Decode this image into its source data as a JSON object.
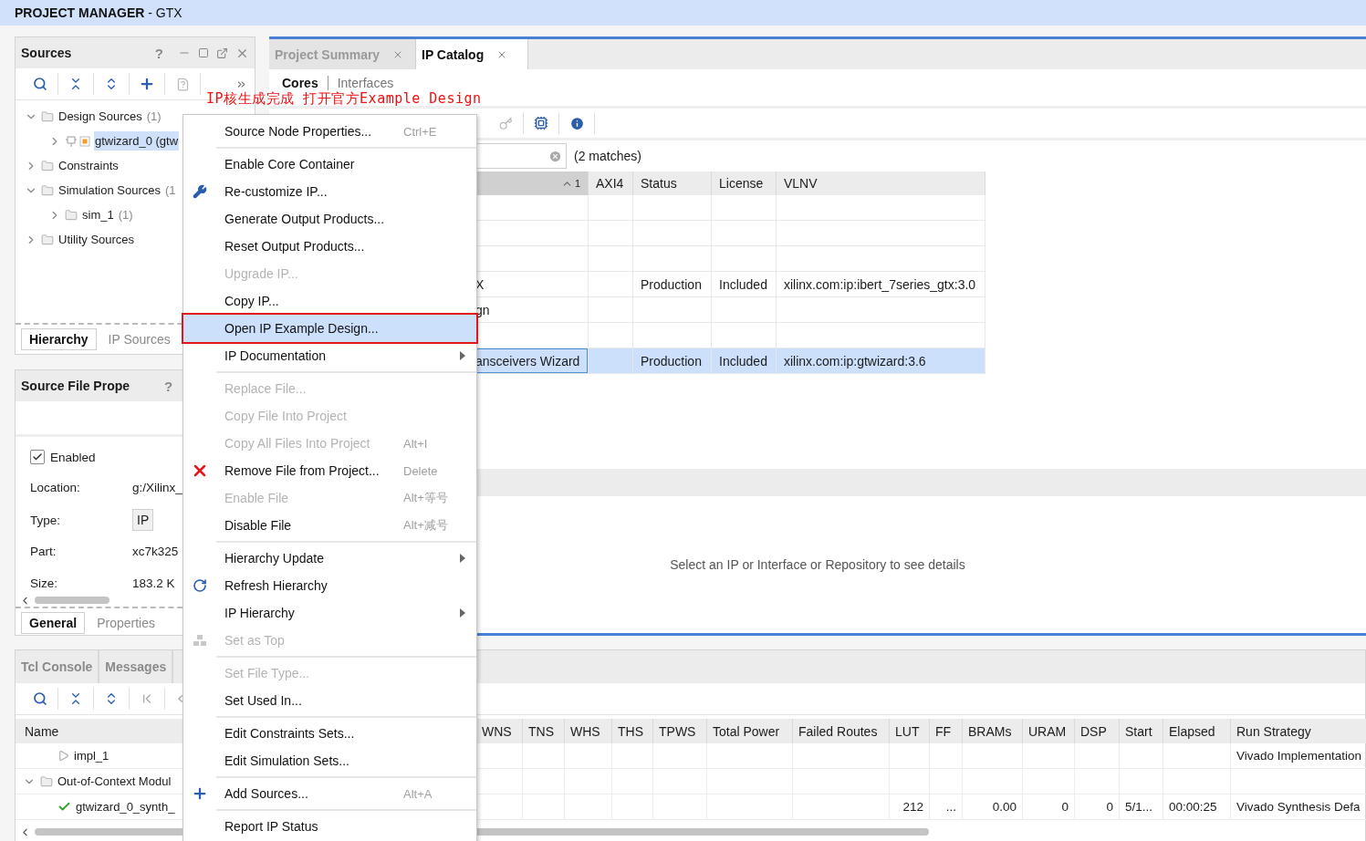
{
  "title_bar": {
    "title": "**PROJECT MANAGER** - GTX"
  },
  "sources_panel": {
    "title": "Sources",
    "help": "?",
    "tree": [
      {
        "label": "Design Sources",
        "count": "(1)",
        "kind": "folder",
        "expanded": true,
        "selected": false,
        "children": [
          {
            "label": "gtwizard_0 (gtw",
            "kind": "ip",
            "expanded": false,
            "selected": true
          }
        ]
      },
      {
        "label": "Constraints",
        "kind": "folder",
        "expanded": false,
        "selected": false
      },
      {
        "label": "Simulation Sources",
        "count": "(1",
        "kind": "folder",
        "expanded": true,
        "selected": false,
        "children": [
          {
            "label": "sim_1",
            "count": "(1)",
            "kind": "folder",
            "expanded": false,
            "selected": false
          }
        ]
      },
      {
        "label": "Utility Sources",
        "kind": "folder",
        "expanded": false,
        "selected": false
      }
    ],
    "tabs": [
      {
        "label": "Hierarchy",
        "selected": true
      },
      {
        "label": "IP Sources",
        "selected": false
      }
    ]
  },
  "properties_panel": {
    "title": "Source File Prope",
    "help": "?",
    "enabled": {
      "label": "Enabled",
      "checked": true
    },
    "fields": [
      {
        "label": "Location:",
        "value": "g:/Xilinx_",
        "kind": "text"
      },
      {
        "label": "Type:",
        "value": "IP",
        "kind": "box"
      },
      {
        "label": "Part:",
        "value": "xc7k325",
        "kind": "text"
      },
      {
        "label": "Size:",
        "value": "183.2 K",
        "kind": "text"
      }
    ],
    "tabs": [
      {
        "label": "General",
        "selected": true
      },
      {
        "label": "Properties",
        "selected": false
      }
    ]
  },
  "editor_panel": {
    "tabs": [
      {
        "label": "Project Summary",
        "selected": false
      },
      {
        "label": "IP Catalog",
        "selected": true
      }
    ],
    "subtabs": [
      {
        "label": "Cores",
        "selected": true
      },
      {
        "label": "Interfaces",
        "selected": false
      }
    ],
    "search": {
      "matches": "(2 matches)"
    },
    "table": {
      "sort_mark": "1",
      "columns": [
        "AXI4",
        "Status",
        "License",
        "VLNV"
      ],
      "rows": [
        {
          "selected": false
        },
        {
          "selected": false
        },
        {
          "selected": false
        },
        {
          "name": "X",
          "status": "Production",
          "license": "Included",
          "vlnv": "xilinx.com:ip:ibert_7series_gtx:3.0",
          "selected": false
        },
        {
          "name": "gn",
          "selected": false
        },
        {
          "selected": false
        },
        {
          "name": "ansceivers Wizard",
          "status": "Production",
          "license": "Included",
          "vlnv": "xilinx.com:ip:gtwizard:3.6",
          "selected": true
        }
      ]
    },
    "details": {
      "message": "Select an IP or Interface or Repository to see details"
    }
  },
  "runs_panel": {
    "tabs": [
      {
        "label": "Tcl Console",
        "selected": false
      },
      {
        "label": "Messages",
        "selected": false
      }
    ],
    "name_column": "Name",
    "columns": [
      "WNS",
      "TNS",
      "WHS",
      "THS",
      "TPWS",
      "Total Power",
      "Failed Routes",
      "LUT",
      "FF",
      "BRAMs",
      "URAM",
      "DSP",
      "Start",
      "Elapsed",
      "Run Strategy"
    ],
    "rows": [
      {
        "name": "impl_1",
        "kind": "run",
        "cells": [
          null,
          null,
          null,
          null,
          null,
          null,
          null,
          null,
          null,
          null,
          null,
          null,
          null,
          null,
          "Vivado Implementation"
        ]
      },
      {
        "name": "Out-of-Context Modul",
        "kind": "folder",
        "cells": [
          null,
          null,
          null,
          null,
          null,
          null,
          null,
          null,
          null,
          null,
          null,
          null,
          null,
          null,
          null
        ]
      },
      {
        "name": "gtwizard_0_synth_",
        "kind": "done",
        "cells": [
          null,
          null,
          null,
          null,
          null,
          null,
          null,
          "212",
          "...",
          "0.00",
          "0",
          "0",
          "5/1...",
          "00:00:25",
          "Vivado Synthesis Defa"
        ]
      }
    ]
  },
  "context_menu": {
    "items": [
      {
        "kind": "plain",
        "label": "Source Node Properties...",
        "shortcut": "Ctrl+E",
        "disabled": false,
        "selected": false,
        "submenu": false
      },
      {
        "kind": "separator"
      },
      {
        "kind": "plain",
        "label": "Enable Core Container",
        "disabled": false,
        "selected": false,
        "submenu": false
      },
      {
        "kind": "wrench",
        "label": "Re-customize IP...",
        "disabled": false,
        "selected": false,
        "submenu": false
      },
      {
        "kind": "plain",
        "label": "Generate Output Products...",
        "disabled": false,
        "selected": false,
        "submenu": false
      },
      {
        "kind": "plain",
        "label": "Reset Output Products...",
        "disabled": false,
        "selected": false,
        "submenu": false
      },
      {
        "kind": "plain",
        "label": "Upgrade IP...",
        "disabled": true,
        "selected": false,
        "submenu": false
      },
      {
        "kind": "plain",
        "label": "Copy IP...",
        "disabled": false,
        "selected": false,
        "submenu": false
      },
      {
        "kind": "plain",
        "label": "Open IP Example Design...",
        "disabled": false,
        "selected": true,
        "submenu": false
      },
      {
        "kind": "plain",
        "label": "IP Documentation",
        "disabled": false,
        "selected": false,
        "submenu": true
      },
      {
        "kind": "separator"
      },
      {
        "kind": "plain",
        "label": "Replace File...",
        "disabled": true,
        "selected": false,
        "submenu": false
      },
      {
        "kind": "plain",
        "label": "Copy File Into Project",
        "disabled": true,
        "selected": false,
        "submenu": false
      },
      {
        "kind": "plain",
        "label": "Copy All Files Into Project",
        "shortcut": "Alt+I",
        "disabled": true,
        "selected": false,
        "submenu": false
      },
      {
        "kind": "remove",
        "label": "Remove File from Project...",
        "shortcut": "Delete",
        "disabled": false,
        "selected": false,
        "submenu": false
      },
      {
        "kind": "plain",
        "label": "Enable File",
        "shortcut": "Alt+等号",
        "disabled": true,
        "selected": false,
        "submenu": false
      },
      {
        "kind": "plain",
        "label": "Disable File",
        "shortcut": "Alt+减号",
        "disabled": false,
        "selected": false,
        "submenu": false
      },
      {
        "kind": "separator"
      },
      {
        "kind": "plain",
        "label": "Hierarchy Update",
        "disabled": false,
        "selected": false,
        "submenu": true
      },
      {
        "kind": "refresh",
        "label": "Refresh Hierarchy",
        "disabled": false,
        "selected": false,
        "submenu": false
      },
      {
        "kind": "plain",
        "label": "IP Hierarchy",
        "disabled": false,
        "selected": false,
        "submenu": true
      },
      {
        "kind": "top",
        "label": "Set as Top",
        "disabled": true,
        "selected": false,
        "submenu": false
      },
      {
        "kind": "separator"
      },
      {
        "kind": "plain",
        "label": "Set File Type...",
        "disabled": true,
        "selected": false,
        "submenu": false
      },
      {
        "kind": "plain",
        "label": "Set Used In...",
        "disabled": false,
        "selected": false,
        "submenu": false
      },
      {
        "kind": "separator"
      },
      {
        "kind": "plain",
        "label": "Edit Constraints Sets...",
        "disabled": false,
        "selected": false,
        "submenu": false
      },
      {
        "kind": "plain",
        "label": "Edit Simulation Sets...",
        "disabled": false,
        "selected": false,
        "submenu": false
      },
      {
        "kind": "separator"
      },
      {
        "kind": "add",
        "label": "Add Sources...",
        "shortcut": "Alt+A",
        "disabled": false,
        "selected": false,
        "submenu": false
      },
      {
        "kind": "separator"
      },
      {
        "kind": "plain",
        "label": "Report IP Status",
        "disabled": false,
        "selected": false,
        "submenu": false
      }
    ]
  },
  "annotation": {
    "text": "IP核生成完成 打开官方Example Design"
  }
}
